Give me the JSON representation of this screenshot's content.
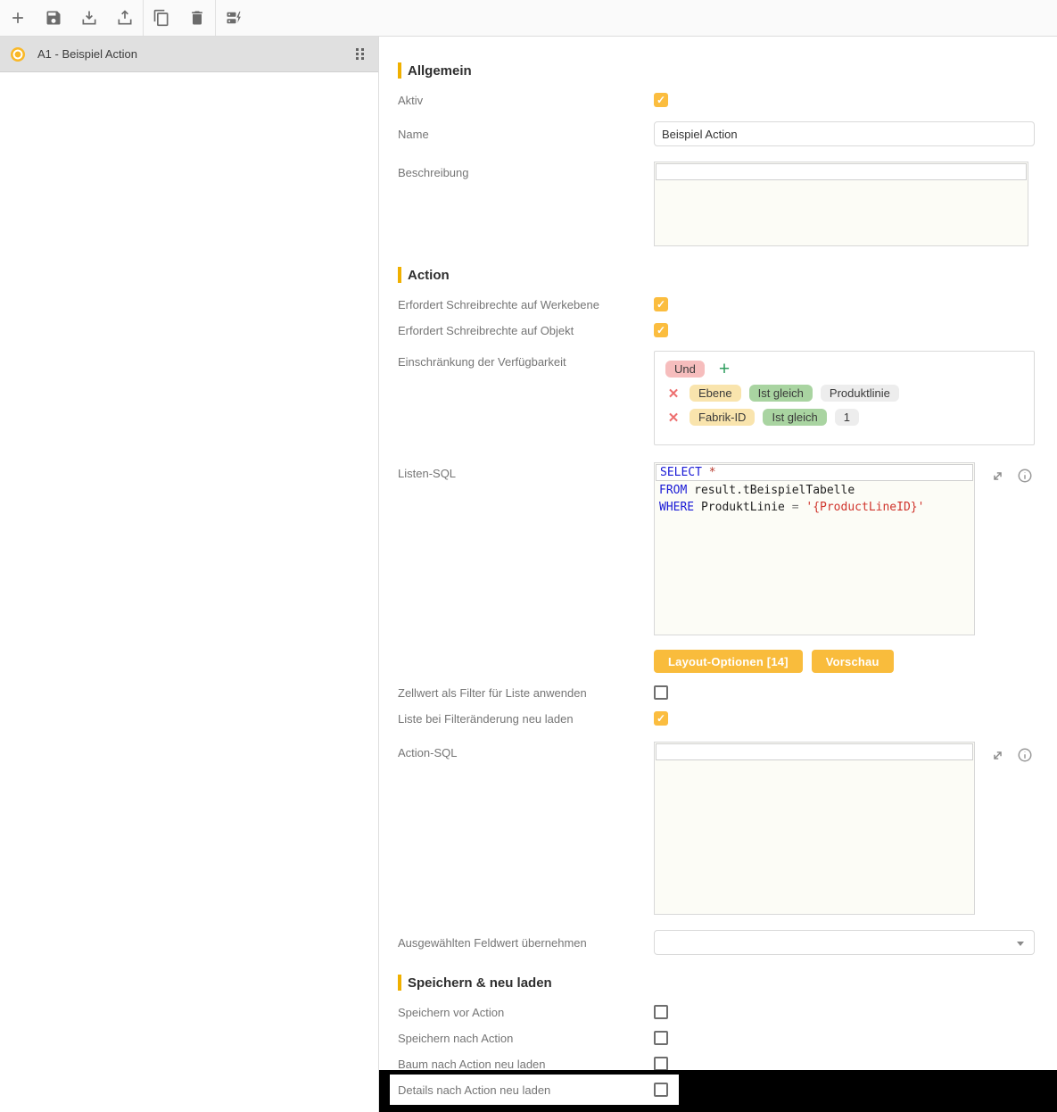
{
  "toolbar": {
    "icons": [
      "add",
      "save",
      "download",
      "upload",
      "copy",
      "delete",
      "run-batch"
    ]
  },
  "sidebar": {
    "selected_item": {
      "label": "A1 - Beispiel Action"
    }
  },
  "general": {
    "title": "Allgemein",
    "aktiv": {
      "label": "Aktiv",
      "checked": true
    },
    "name": {
      "label": "Name",
      "value": "Beispiel Action"
    },
    "beschreibung": {
      "label": "Beschreibung",
      "value": ""
    }
  },
  "action": {
    "title": "Action",
    "schreibrechte_werkebene": {
      "label": "Erfordert Schreibrechte auf Werkebene",
      "checked": true
    },
    "schreibrechte_objekt": {
      "label": "Erfordert Schreibrechte auf Objekt",
      "checked": true
    },
    "einschraenkung": {
      "label": "Einschränkung der Verfügbarkeit",
      "operator": "Und",
      "add_symbol": "+",
      "remove_symbol": "✕",
      "rows": [
        {
          "field": "Ebene",
          "operator": "Ist gleich",
          "value": "Produktlinie"
        },
        {
          "field": "Fabrik-ID",
          "operator": "Ist gleich",
          "value": "1"
        }
      ]
    },
    "listen_sql": {
      "label": "Listen-SQL",
      "code_text": "SELECT *\nFROM result.tBeispielTabelle\nWHERE ProduktLinie = '{ProductLineID}'",
      "code_lines": [
        [
          {
            "c": "kw",
            "t": "SELECT"
          },
          {
            "c": "pl",
            "t": " "
          },
          {
            "c": "star",
            "t": "*"
          }
        ],
        [
          {
            "c": "kw",
            "t": "FROM"
          },
          {
            "c": "pl",
            "t": " result.tBeispielTabelle"
          }
        ],
        [
          {
            "c": "kw",
            "t": "WHERE"
          },
          {
            "c": "pl",
            "t": " ProduktLinie "
          },
          {
            "c": "op",
            "t": "="
          },
          {
            "c": "pl",
            "t": " "
          },
          {
            "c": "str",
            "t": "'{ProductLineID}'"
          }
        ]
      ]
    },
    "layout_optionen_button": "Layout-Optionen [14]",
    "vorschau_button": "Vorschau",
    "zellwert_filter": {
      "label": "Zellwert als Filter für Liste anwenden",
      "checked": false
    },
    "liste_neu_laden": {
      "label": "Liste bei Filteränderung neu laden",
      "checked": true
    },
    "action_sql": {
      "label": "Action-SQL",
      "value": ""
    },
    "feldwert": {
      "label": "Ausgewählten Feldwert übernehmen",
      "value": ""
    }
  },
  "speichern": {
    "title": "Speichern & neu laden",
    "rows": [
      {
        "label": "Speichern vor Action",
        "checked": false
      },
      {
        "label": "Speichern nach Action",
        "checked": false
      },
      {
        "label": "Baum nach Action neu laden",
        "checked": false
      },
      {
        "label": "Details nach Action neu laden",
        "checked": false
      }
    ]
  }
}
